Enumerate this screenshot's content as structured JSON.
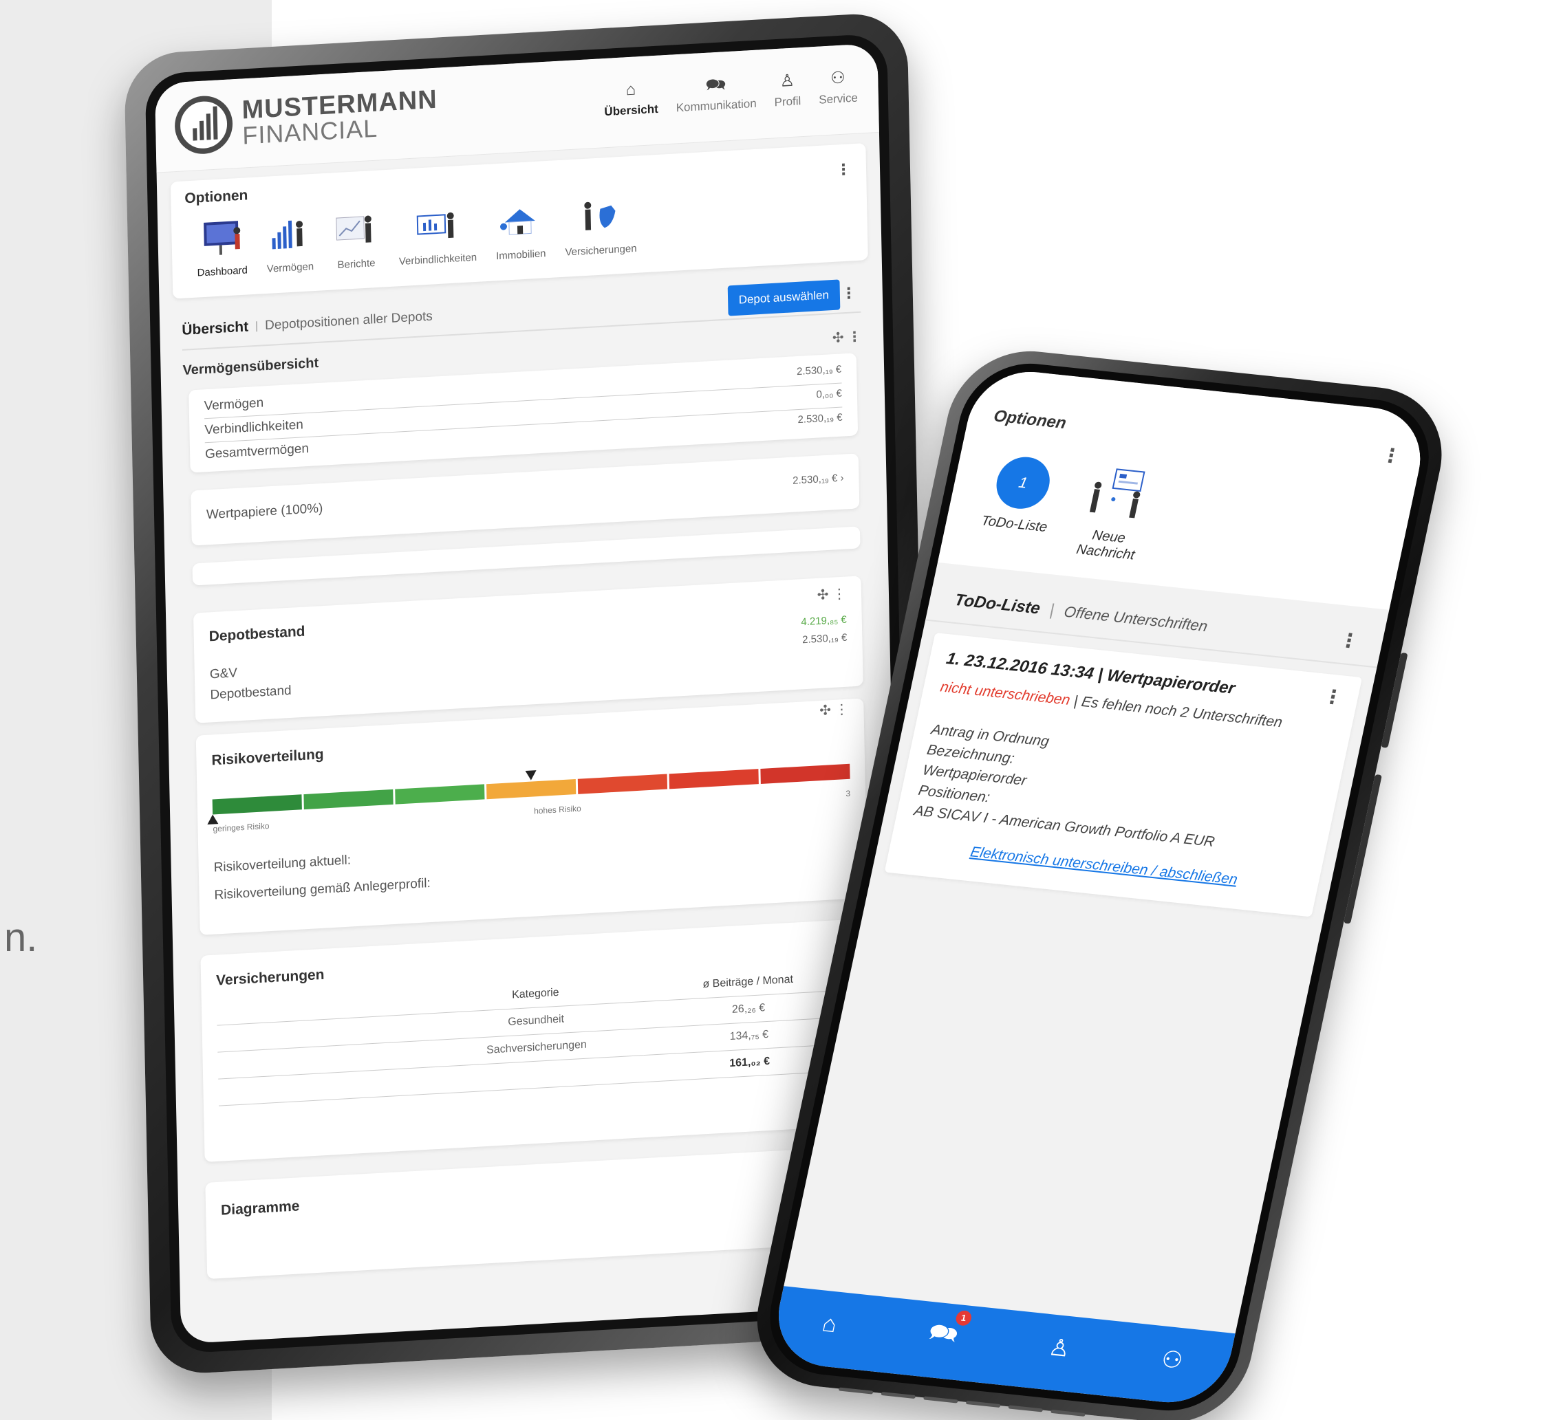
{
  "background": {
    "fragment": "n."
  },
  "tablet": {
    "logo": {
      "line1": "MUSTERMANN",
      "line2": "FINANCIAL"
    },
    "nav": [
      {
        "label": "Übersicht",
        "icon": "home-icon",
        "glyph": "⌂",
        "active": true
      },
      {
        "label": "Kommunikation",
        "icon": "chat-icon",
        "glyph": "🗪",
        "active": false
      },
      {
        "label": "Profil",
        "icon": "user-icon",
        "glyph": "♙",
        "active": false
      },
      {
        "label": "Service",
        "icon": "users-icon",
        "glyph": "⚇",
        "active": false
      }
    ],
    "options": {
      "title": "Optionen",
      "items": [
        {
          "label": "Dashboard",
          "icon": "dashboard-icon"
        },
        {
          "label": "Vermögen",
          "icon": "assets-icon"
        },
        {
          "label": "Berichte",
          "icon": "reports-icon"
        },
        {
          "label": "Verbindlichkeiten",
          "icon": "liabilities-icon"
        },
        {
          "label": "Immobilien",
          "icon": "real-estate-icon"
        },
        {
          "label": "Versicherungen",
          "icon": "insurance-icon"
        }
      ]
    },
    "overview": {
      "title": "Übersicht",
      "subtitle": "Depotpositionen aller Depots",
      "button": "Depot auswählen"
    },
    "wealth": {
      "title": "Vermögensübersicht",
      "rows": [
        {
          "label": "Vermögen",
          "value": "2.530,₁₉ €"
        },
        {
          "label": "Verbindlichkeiten",
          "value": "0,₀₀ €"
        },
        {
          "label": "Gesamtvermögen",
          "value": "2.530,₁₉ €"
        }
      ]
    },
    "securities": {
      "label": "Wertpapiere (100%)",
      "value": "2.530,₁₉ € ›"
    },
    "depot": {
      "title": "Depotbestand",
      "green_value": "4.219,₈₅ €",
      "rows": [
        {
          "label": "G&V",
          "value": "2.530,₁₉ €"
        },
        {
          "label": "Depotbestand",
          "value": ""
        }
      ]
    },
    "risk": {
      "title": "Risikoverteilung",
      "low_label": "geringes Risiko",
      "high_label": "hohes Risiko",
      "edge_value": "3",
      "marker_fraction": 0.5,
      "segments": [
        "#2e8b3a",
        "#42a347",
        "#4cae4c",
        "#f2a83a",
        "#e0492f",
        "#dc3e2c",
        "#d2352a"
      ],
      "current_label": "Risikoverteilung aktuell:",
      "profile_label": "Risikoverteilung gemäß Anlegerprofil:"
    },
    "insurance": {
      "title": "Versicherungen",
      "header_cut": "Be",
      "columns": [
        "Kategorie",
        "ø Beiträge / Monat"
      ],
      "rows": [
        {
          "category": "Gesundheit",
          "amount": "26,₂₆ €"
        },
        {
          "category": "Sachversicherungen",
          "amount": "134,₇₅ €"
        },
        {
          "category": "",
          "amount": "161,₀₂ €"
        }
      ]
    },
    "charts": {
      "title": "Diagramme"
    }
  },
  "phone": {
    "options": {
      "title": "Optionen",
      "todo_count": "1",
      "todo_label": "ToDo-Liste",
      "message_label_1": "Neue",
      "message_label_2": "Nachricht"
    },
    "section": {
      "title": "ToDo-Liste",
      "subtitle": "Offene Unterschriften"
    },
    "item": {
      "head": "1. 23.12.2016 13:34 | Wertpapierorder",
      "status_red": "nicht unterschrieben",
      "status_rest": "| Es fehlen noch 2 Unterschriften",
      "line1": "Antrag in Ordnung",
      "line2": "Bezeichnung:",
      "line3": "Wertpapierorder",
      "line4": "Positionen:",
      "line5": "AB SICAV I - American Growth Portfolio A EUR",
      "link": "Elektronisch unterschreiben / abschließen"
    },
    "tabbar": [
      {
        "icon": "home-icon",
        "glyph": "⌂"
      },
      {
        "icon": "chat-icon",
        "glyph": "🗪",
        "badge": "1"
      },
      {
        "icon": "user-icon",
        "glyph": "♙"
      },
      {
        "icon": "users-icon",
        "glyph": "⚇"
      }
    ],
    "accent": "#1677e6"
  }
}
